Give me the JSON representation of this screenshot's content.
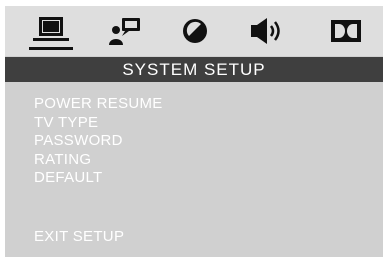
{
  "colors": {
    "icon_bar_bg": "#dedede",
    "panel_bg": "#d0d0d0",
    "title_bar_bg": "#3f3f3f",
    "text": "#ffffff",
    "icon": "#111111"
  },
  "tabs": [
    {
      "icon": "monitor-icon",
      "selected": true
    },
    {
      "icon": "speech-person-icon",
      "selected": false
    },
    {
      "icon": "half-circle-icon",
      "selected": false
    },
    {
      "icon": "speaker-icon",
      "selected": false
    },
    {
      "icon": "dolby-icon",
      "selected": false
    }
  ],
  "title": "SYSTEM SETUP",
  "menu": {
    "items": [
      "POWER RESUME",
      "TV  TYPE",
      "PASSWORD",
      "RATING",
      "DEFAULT"
    ],
    "exit": "EXIT  SETUP"
  }
}
